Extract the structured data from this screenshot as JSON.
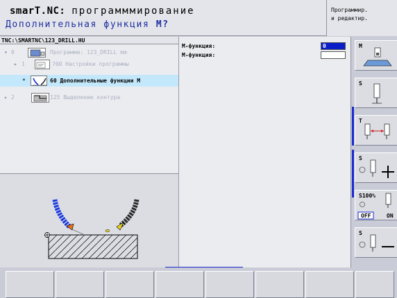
{
  "header": {
    "title_prefix": "smarT.NC:",
    "title_mode": "программмирование",
    "subtitle": "Дополнительная функция",
    "subtitle_key": "M?",
    "mode_line1": "Программир.",
    "mode_line2": "и редактир."
  },
  "tree": {
    "path": "TNC:\\SMARTNC\\123_DRILL.HU",
    "rows": [
      {
        "mark": "▾",
        "num": "0",
        "text": "Программа: 123_DRILL mm"
      },
      {
        "mark": "▸",
        "num": "1",
        "text": "700 Настройки программы"
      },
      {
        "mark": "*",
        "num": "",
        "text": "60 Дополнительные функции M"
      },
      {
        "mark": "▸",
        "num": "2",
        "text": "125 Выделение контура"
      }
    ]
  },
  "form": {
    "rows": [
      {
        "label": "M-функция:",
        "value": "0"
      },
      {
        "label": "M-функция:",
        "value": ""
      }
    ]
  },
  "softkeys": {
    "m_label": "M",
    "s_label": "S",
    "t_label": "T",
    "s_plus_label": "S",
    "s100_label": "S100%",
    "off_label": "OFF",
    "on_label": "ON",
    "s_minus_label": "S"
  },
  "colors": {
    "accent": "#1a2ad0",
    "selection": "#c4e8fb",
    "subtitle": "#1d2fa0"
  }
}
